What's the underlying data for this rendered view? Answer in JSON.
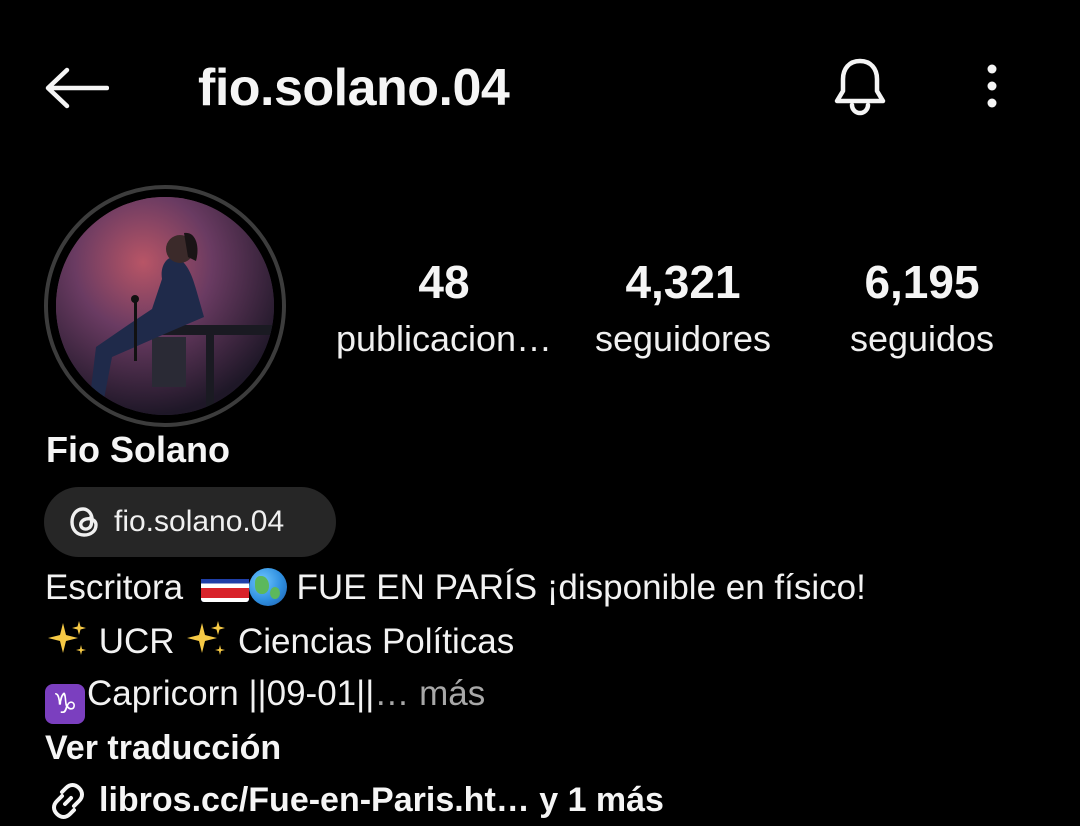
{
  "header": {
    "back_icon": "arrow-left-icon",
    "username": "fio.solano.04",
    "bell_icon": "bell-icon",
    "more_icon": "more-vertical-icon"
  },
  "profile": {
    "avatar_alt": "profile-photo",
    "display_name": "Fio Solano"
  },
  "stats": [
    {
      "value": "48",
      "label": "publicacion…"
    },
    {
      "value": "4,321",
      "label": "seguidores"
    },
    {
      "value": "6,195",
      "label": "seguidos"
    }
  ],
  "threads": {
    "icon": "threads-icon",
    "label": "fio.solano.04"
  },
  "bio": {
    "line1_prefix": "Escritora ",
    "line1_suffix": " FUE EN PARÍS ¡disponible en físico!",
    "line2": " UCR ",
    "line2_suffix": " Ciencias Políticas",
    "line3": "Capricorn ||09-01||",
    "line3_more": "… más",
    "zodiac_symbol": "♑",
    "flag_icon": "costa-rica-flag-icon",
    "globe_icon": "globe-icon",
    "sparkle_icon": "sparkles-icon"
  },
  "translate_label": "Ver traducción",
  "link": {
    "icon": "link-icon",
    "text": "libros.cc/Fue-en-Paris.ht… y 1 más"
  },
  "colors": {
    "background": "#000000",
    "text": "#f5f5f5",
    "muted": "#a8a8a8",
    "chip_bg": "#262626",
    "avatar_ring": "#3c3c3c"
  }
}
